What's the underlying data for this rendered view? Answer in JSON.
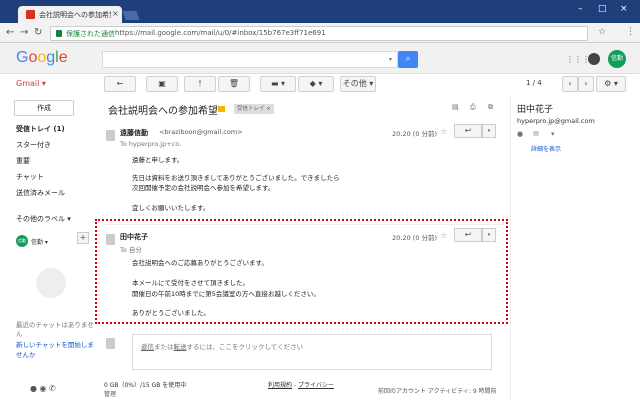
{
  "browser": {
    "tab_title": "会社説明会への参加希望",
    "secure_label": "保護された通信",
    "url": "https://mail.google.com/mail/u/0/#inbox/15b767e3ff71e691"
  },
  "header": {
    "logo": "Google"
  },
  "toolbar": {
    "gmail_label": "Gmail ▾",
    "more_label": "その他 ▾",
    "page_count": "1 / 4"
  },
  "leftnav": {
    "compose_label": "作成",
    "items": [
      {
        "label": "受信トレイ (1)",
        "active": true
      },
      {
        "label": "スター付き"
      },
      {
        "label": "重要"
      },
      {
        "label": "チャット"
      },
      {
        "label": "送信済みメール"
      },
      {
        "label": "その他のラベル ▾"
      }
    ],
    "chat_user": "信勤 ▾",
    "chat_avatar": "信勤",
    "chat_note": "最近のチャットはありません",
    "chat_start": "新しいチャットを開始しませんか"
  },
  "thread": {
    "subject": "会社説明会への参加希望",
    "label": "受信トレイ ×",
    "messages": [
      {
        "sender": "遠藤信勤",
        "email": "<braziboon@gmail.com>",
        "to": "To hyperpro.jp+co.",
        "time": "20:20 (0 分前)",
        "body": [
          "遠藤と申します。",
          "",
          "先日は資料をお送り頂きましてありがとうございました。できましたら",
          "次回開催予定の会社説明会へ参加を希望します。",
          "",
          "宜しくお願いいたします。"
        ]
      },
      {
        "sender": "田中花子",
        "email": "",
        "to": "To 自分",
        "time": "20:20 (0 分前)",
        "body": [
          "会社説明会へのご応募ありがとうございます。",
          "",
          "本メールにて受付をさせて頂きました。",
          "開催日の午前10時までに第5会議室の方へ直接お越しください。",
          "",
          "ありがとうございました。"
        ]
      }
    ],
    "reply_prompt_pre": "",
    "reply_link1": "返信",
    "reply_mid": "または",
    "reply_link2": "転送",
    "reply_post": "するには、ここをクリックしてください"
  },
  "footer": {
    "storage": "0 GB（0%）/15 GB を使用中",
    "manage": "管理",
    "terms": "利用規約",
    "privacy": "プライバシー",
    "activity": "前回のアカウント アクティビティ: 9 時間前"
  },
  "contact": {
    "name": "田中花子",
    "email": "hyperpro.jp@gmail.com",
    "details": "詳細を表示"
  },
  "colors": {
    "brand_red": "#d23f31",
    "search_blue": "#4285f4",
    "highlight": "#d0021b"
  }
}
